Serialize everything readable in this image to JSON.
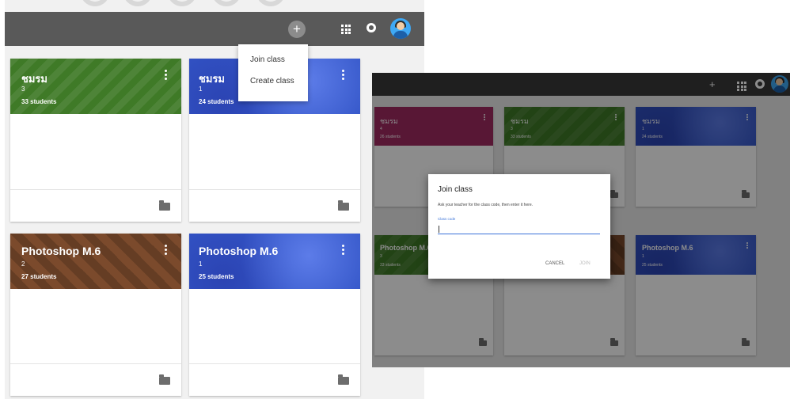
{
  "left": {
    "classes": [
      {
        "title": "ชมรม",
        "section": "3",
        "students": "33 students"
      },
      {
        "title": "ชมรม",
        "section": "1",
        "students": "24 students"
      },
      {
        "title": "Photoshop M.6",
        "section": "2",
        "students": "27 students"
      },
      {
        "title": "Photoshop M.6",
        "section": "1",
        "students": "25 students"
      }
    ],
    "add_icon": "+",
    "menu": {
      "join": "Join class",
      "create": "Create class"
    }
  },
  "right": {
    "add_icon": "+",
    "classes": [
      {
        "title": "ชมรม",
        "section": "4",
        "students": "26 students"
      },
      {
        "title": "ชมรม",
        "section": "3",
        "students": "33 students"
      },
      {
        "title": "ชมรม",
        "section": "1",
        "students": "24 students"
      },
      {
        "title": "Photoshop M.6",
        "section": "3",
        "students": "33 students"
      },
      {
        "title": "Photoshop M.6",
        "section": "1",
        "students": "25 students"
      }
    ],
    "dialog": {
      "title": "Join class",
      "description": "Ask your teacher for the class code, then enter it here.",
      "code_label": "Class code",
      "code_value": "",
      "cancel": "CANCEL",
      "join": "JOIN"
    }
  },
  "colors": {
    "topbar_left": "#595959",
    "topbar_right": "#393939",
    "green": "#3f7a27",
    "blue": "#3355c7",
    "brown": "#7b4a2c",
    "magenta": "#a02a62",
    "link_blue": "#3b73d8"
  },
  "icons": [
    "plus-icon",
    "apps-grid-icon",
    "notifications-icon",
    "avatar",
    "kebab-menu-icon",
    "folder-icon"
  ]
}
